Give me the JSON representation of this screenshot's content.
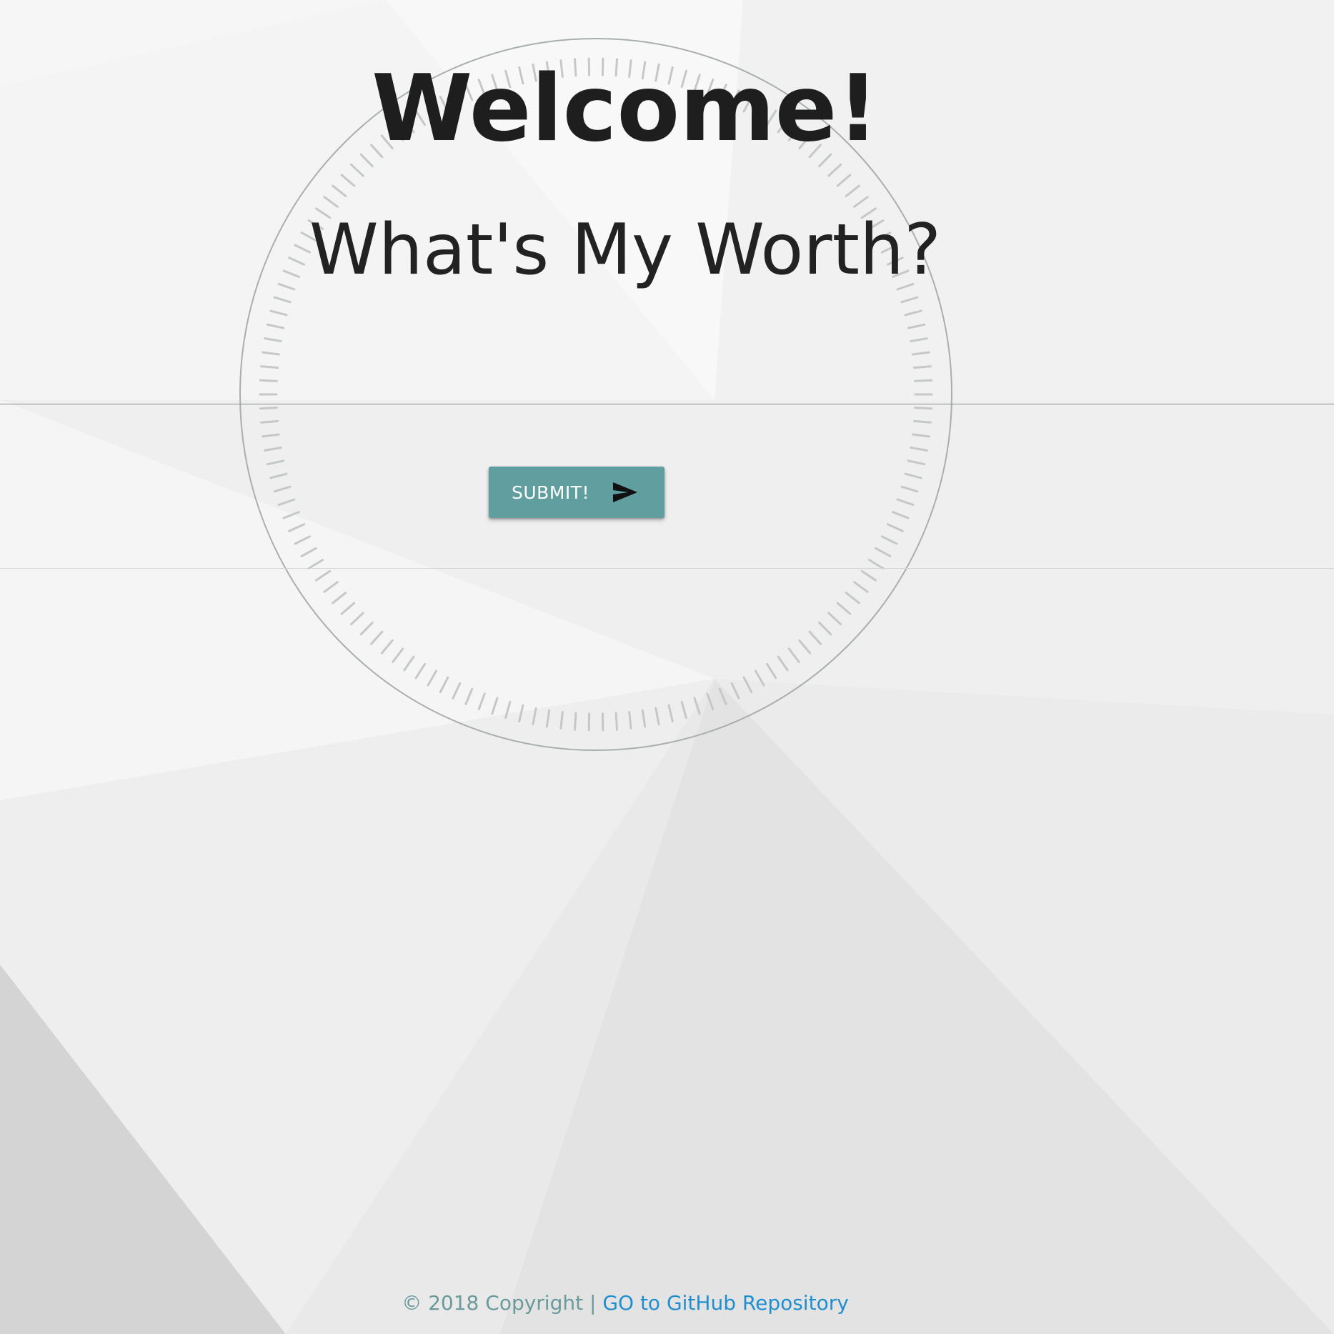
{
  "header": {
    "title": "Welcome!",
    "subtitle": "What's My Worth?"
  },
  "form": {
    "submit_label": "SUBMIT!",
    "submit_icon": "send-icon"
  },
  "footer": {
    "copyright": "© 2018 Copyright | ",
    "link_label": "GO to GitHub Repository"
  },
  "colors": {
    "button": "#609e9f",
    "link": "#1f8fcf",
    "footer_text": "#6a9a9b",
    "heading": "#1e1e1e"
  }
}
